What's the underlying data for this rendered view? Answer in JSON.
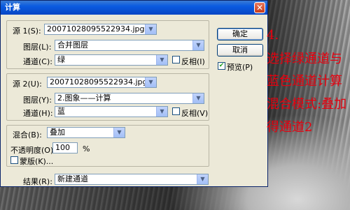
{
  "dialog": {
    "title": "计算",
    "close_glyph": "✕",
    "source1": {
      "label": "源 1(S):",
      "file": "20071028095522934.jpg",
      "layer_label": "图层(L):",
      "layer": "合并图层",
      "channel_label": "通道(C):",
      "channel": "绿",
      "invert_label": "反相(I)",
      "invert_checked": false
    },
    "source2": {
      "label": "源 2(U):",
      "file": "20071028095522934.jpg",
      "layer_label": "图层(Y):",
      "layer": "2.图象——计算",
      "channel_label": "通道(H):",
      "channel": "蓝",
      "invert_label": "反相(V)",
      "invert_checked": false
    },
    "blending": {
      "label": "混合(B):",
      "mode": "叠加",
      "opacity_label": "不透明度(O):",
      "opacity": "100",
      "opacity_unit": "%",
      "mask_label": "蒙版(K)...",
      "mask_checked": false
    },
    "result": {
      "label": "结果(R):",
      "value": "新建通道"
    },
    "buttons": {
      "ok": "确定",
      "cancel": "取消",
      "preview_label": "预览(P)",
      "preview_checked": true
    },
    "dropdown_arrow": "▼",
    "check_glyph": "✔"
  },
  "annotation": {
    "lines": [
      "4.",
      "选择绿通道与",
      "蓝色通道计算",
      "混合模式:叠加",
      "得通道2"
    ],
    "color": "#e8000e"
  }
}
